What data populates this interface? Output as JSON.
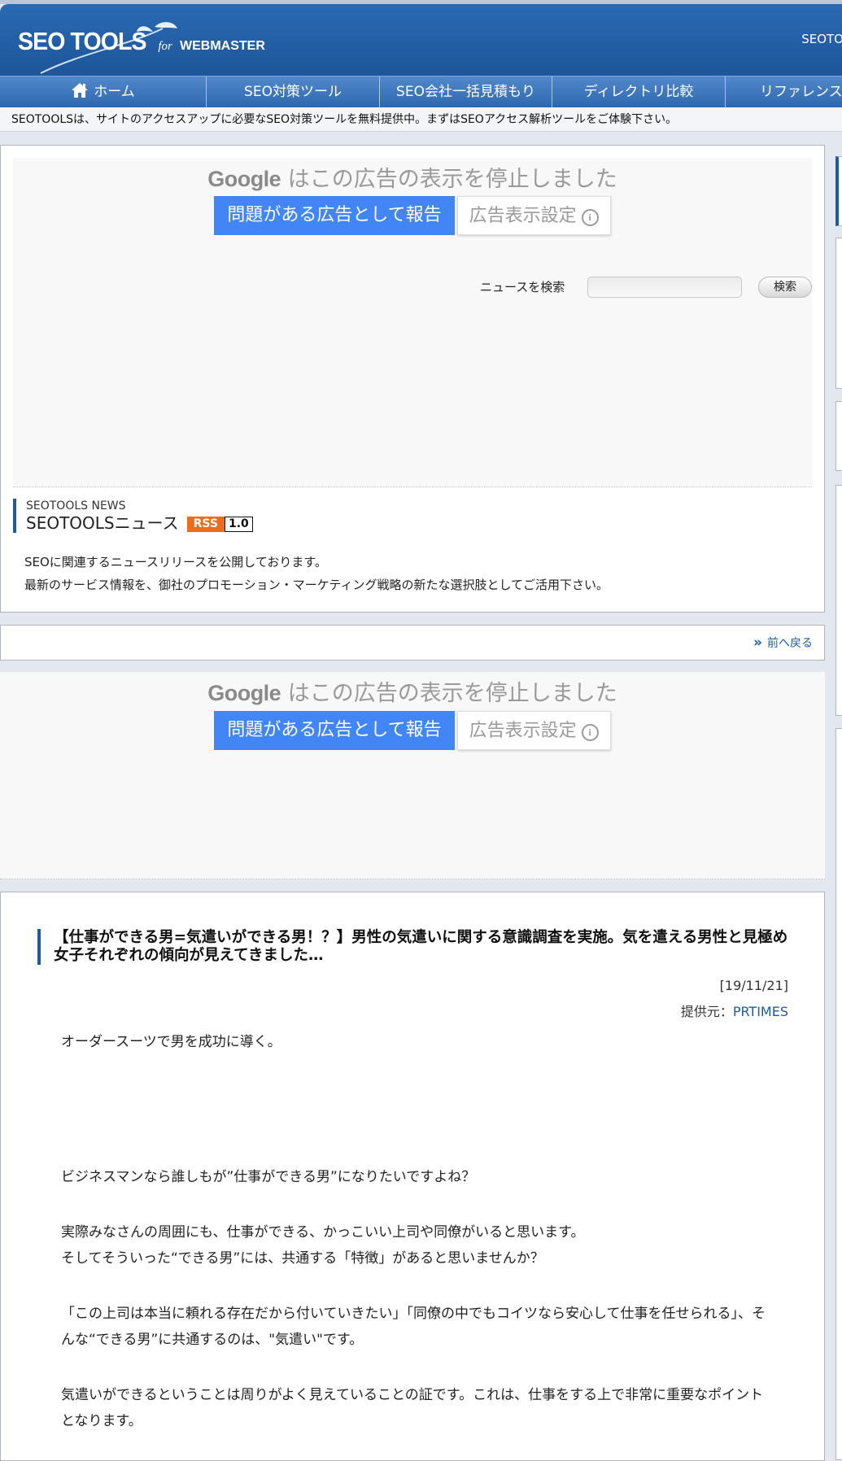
{
  "header": {
    "logo_main": "SEO TOOLS",
    "logo_for": "for",
    "logo_webmaster": "WEBMASTER",
    "right_text": "SEOTO"
  },
  "nav": {
    "items": [
      {
        "label": "ホーム",
        "icon": "home-icon"
      },
      {
        "label": "SEO対策ツール"
      },
      {
        "label": "SEO会社一括見積もり"
      },
      {
        "label": "ディレクトリ比較"
      },
      {
        "label": "リファレンス"
      }
    ]
  },
  "tagline": "SEOTOOLSは、サイトのアクセスアップに必要なSEO対策ツールを無料提供中。まずはSEOアクセス解析ツールをご体験下さい。",
  "ad": {
    "google": "Google",
    "stopped": "はこの広告の表示を停止しました",
    "report": "問題がある広告として報告",
    "settings": "広告表示設定",
    "info_glyph": "i"
  },
  "search": {
    "label": "ニュースを検索",
    "value": "",
    "button": "検索"
  },
  "news": {
    "en": "SEOTOOLS NEWS",
    "jp": "SEOTOOLSニュース",
    "rss": "RSS",
    "rss_version": "1.0",
    "desc1": "SEOに関連するニュースリリースを公開しております。",
    "desc2": "最新のサービス情報を、御社のプロモーション・マーケティング戦略の新たな選択肢としてご活用下さい。"
  },
  "pager": {
    "chevron": "»",
    "back": "前へ戻る"
  },
  "article": {
    "title": "【仕事ができる男=気遣いができる男！？】男性の気遣いに関する意識調査を実施。気を遣える男性と見極め女子それぞれの傾向が見えてきました…",
    "date": "[19/11/21]",
    "source_label": "提供元：",
    "source_link": "PRTIMES",
    "p1": "オーダースーツで男を成功に導く。",
    "p2": "ビジネスマンなら誰しもが”仕事ができる男”になりたいですよね？",
    "p3a": "実際みなさんの周囲にも、仕事ができる、かっこいい上司や同僚がいると思います。",
    "p3b": "そしてそういった“できる男”には、共通する「特徴」があると思いませんか？",
    "p4": "「この上司は本当に頼れる存在だから付いていきたい」「同僚の中でもコイツなら安心して仕事を任せられる」、そんな“できる男”に共通するのは、\"気遣い\"です。",
    "p5": "気遣いができるということは周りがよく見えていることの証です。これは、仕事をする上で非常に重要なポイントとなります。"
  }
}
